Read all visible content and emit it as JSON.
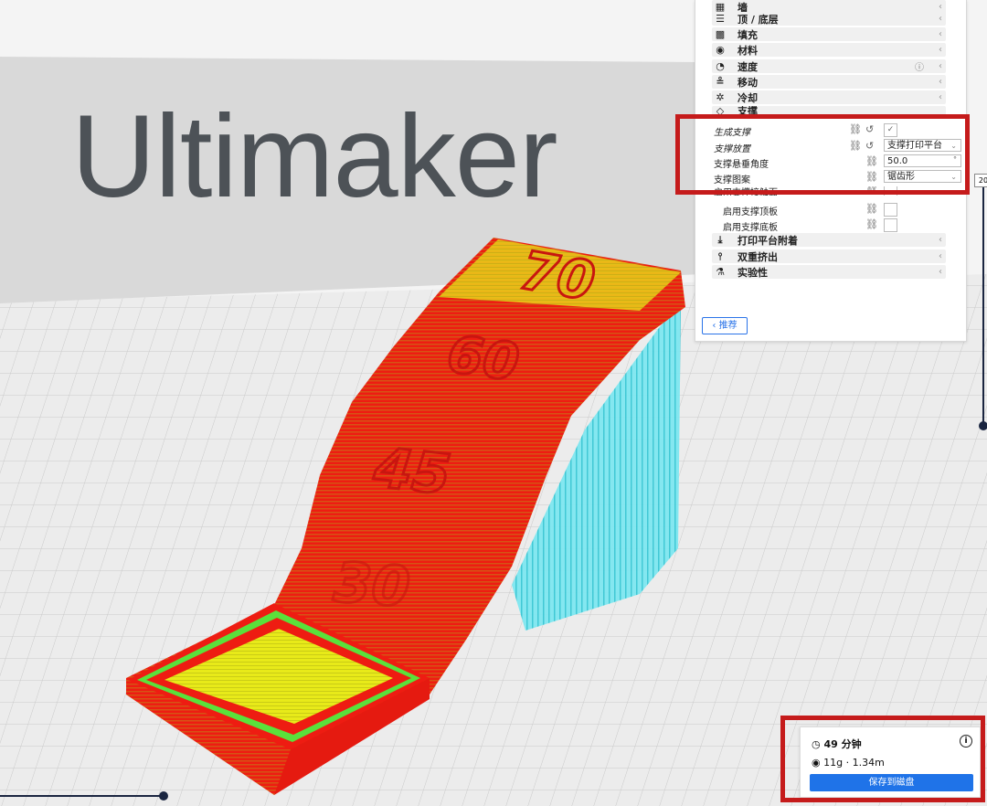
{
  "viewport": {
    "brand_text": "Ultimaker",
    "part_labels": [
      "70",
      "60",
      "45",
      "30"
    ],
    "colors": {
      "outer_wall": "#ee1c12",
      "top_skin": "#e8ea19",
      "support": "#7fe7f0",
      "grid": "#c9c9c9",
      "highlight": "#c51b1b"
    }
  },
  "settings": {
    "categories_top": [
      {
        "icon": "wall-icon",
        "glyph": "▦",
        "label": "墙"
      },
      {
        "icon": "top-bottom-icon",
        "glyph": "☰",
        "label": "顶 / 底层"
      },
      {
        "icon": "infill-icon",
        "glyph": "▩",
        "label": "填充"
      },
      {
        "icon": "material-icon",
        "glyph": "◉",
        "label": "材料"
      },
      {
        "icon": "speed-icon",
        "glyph": "◔",
        "label": "速度"
      },
      {
        "icon": "travel-icon",
        "glyph": "≗",
        "label": "移动"
      },
      {
        "icon": "cooling-icon",
        "glyph": "✲",
        "label": "冷却"
      },
      {
        "icon": "support-icon",
        "glyph": "◇",
        "label": "支撑"
      }
    ],
    "support_rows": [
      {
        "label": "生成支撑"
      },
      {
        "label": "支撑放置",
        "value": "支撑打印平台"
      },
      {
        "label": "支撑悬垂角度",
        "value": "50.0",
        "unit": "°"
      },
      {
        "label": "支撑图案",
        "value": "锯齿形"
      },
      {
        "label": "启用支撑接触面"
      },
      {
        "label": "启用支撑顶板"
      },
      {
        "label": "启用支撑底板"
      }
    ],
    "categories_bottom": [
      {
        "icon": "adhesion-icon",
        "glyph": "⤓",
        "label": "打印平台附着"
      },
      {
        "icon": "dual-extrusion-icon",
        "glyph": "⫯",
        "label": "双重挤出"
      },
      {
        "icon": "experimental-icon",
        "glyph": "⚗",
        "label": "实验性"
      }
    ],
    "recommended_button": "‹ 推荐"
  },
  "layer_slider": {
    "top_value": "20"
  },
  "estimate": {
    "time": "49 分钟",
    "material": "11g · 1.34m",
    "save_button": "保存到磁盘"
  }
}
